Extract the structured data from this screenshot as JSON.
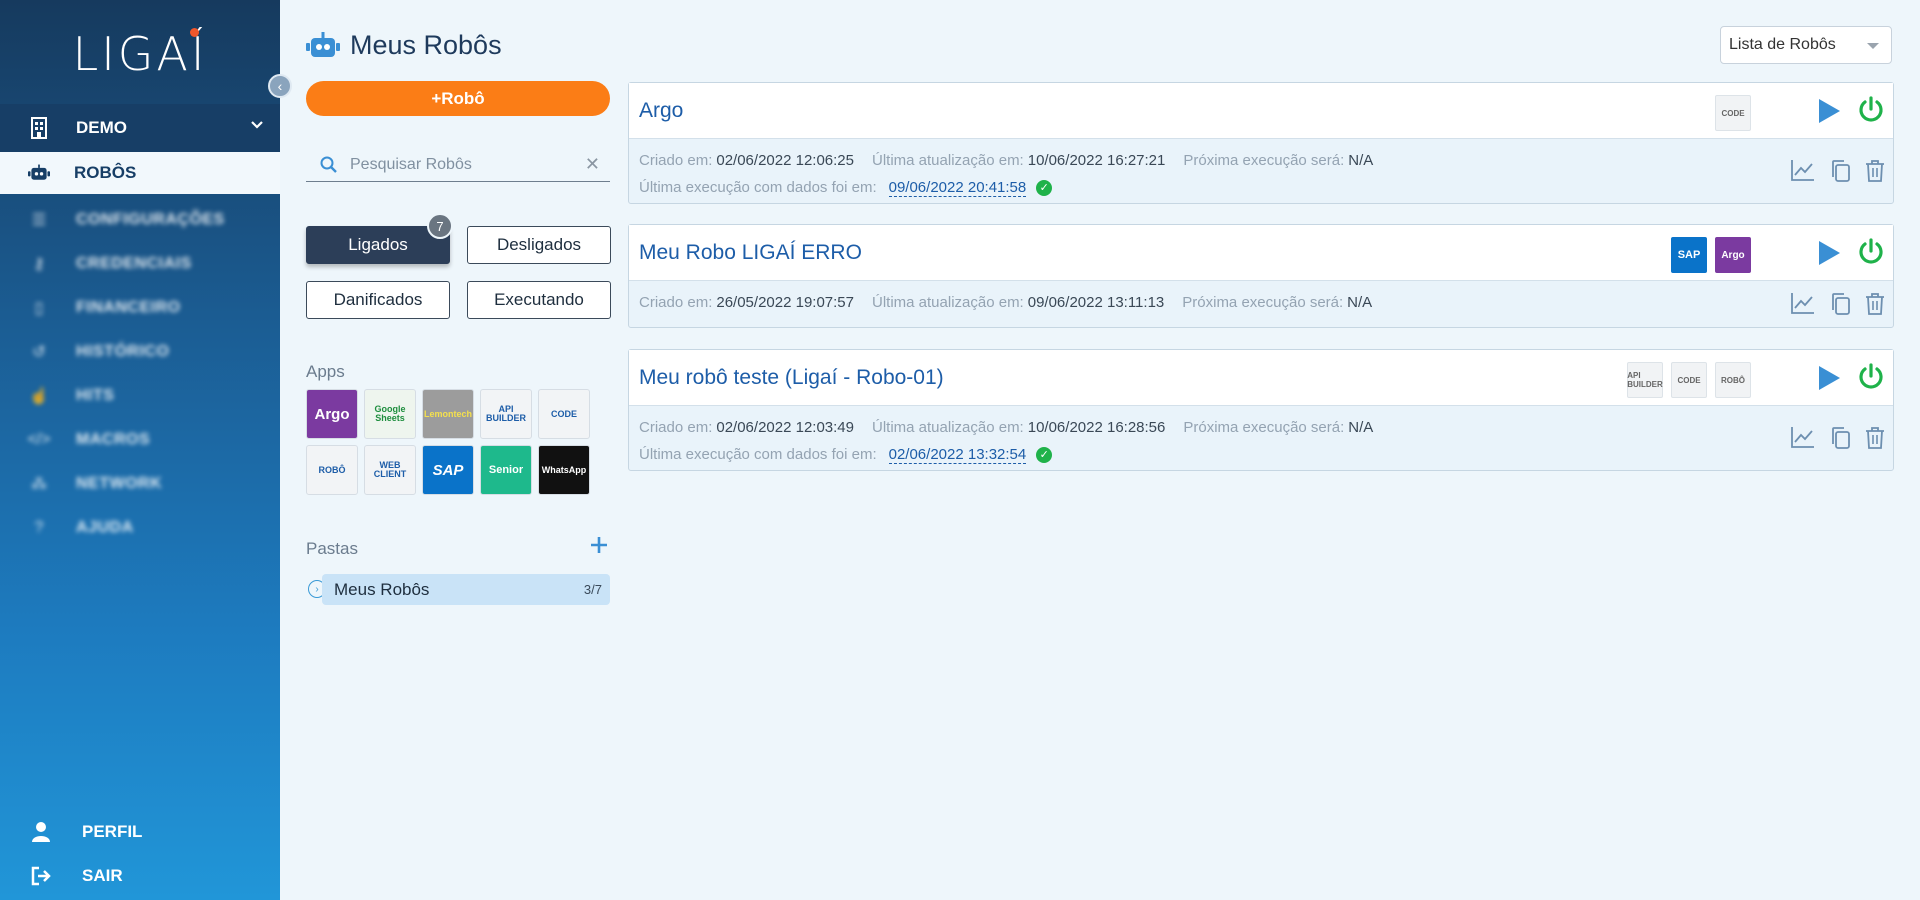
{
  "brand": {
    "logo_text": "LIGAÍ"
  },
  "sidebar": {
    "org": "DEMO",
    "active": "ROBÔS",
    "items": [
      "CONFIGURAÇÕES",
      "CREDENCIAIS",
      "FINANCEIRO",
      "HISTÓRICO",
      "HITS",
      "MACROS",
      "NETWORK",
      "AJUDA"
    ],
    "profile": "PERFIL",
    "logout": "SAIR"
  },
  "panel": {
    "title": "Meus Robôs",
    "add_label": "+Robô",
    "search_placeholder": "Pesquisar Robôs",
    "filters": {
      "on": "Ligados",
      "on_count": "7",
      "off": "Desligados",
      "broken": "Danificados",
      "running": "Executando"
    },
    "apps_label": "Apps",
    "apps": [
      {
        "label": "Argo",
        "bg": "#7b3aa0",
        "fg": "#ffffff"
      },
      {
        "label": "Google Sheets",
        "bg": "#eef5ee",
        "fg": "#1e8e3e"
      },
      {
        "label": "Lemontech",
        "bg": "#9c9c9c",
        "fg": "#f4e04d"
      },
      {
        "label": "API BUILDER",
        "bg": "#f2f4f6",
        "fg": "#1d5da8"
      },
      {
        "label": "CODE",
        "bg": "#f2f4f6",
        "fg": "#1d5da8"
      },
      {
        "label": "ROBÔ",
        "bg": "#f2f4f6",
        "fg": "#1d5da8"
      },
      {
        "label": "WEB CLIENT",
        "bg": "#f2f4f6",
        "fg": "#1d5da8"
      },
      {
        "label": "SAP",
        "bg": "#0a73c9",
        "fg": "#ffffff"
      },
      {
        "label": "Senior",
        "bg": "#1eb98c",
        "fg": "#ffffff"
      },
      {
        "label": "WhatsApp",
        "bg": "#111111",
        "fg": "#ffffff"
      }
    ],
    "folders_label": "Pastas",
    "folders": [
      {
        "name": "Meus Robôs",
        "count": "3/7"
      }
    ]
  },
  "view_select": {
    "value": "Lista de Robôs"
  },
  "labels": {
    "created": "Criado em:",
    "updated": "Última atualização em:",
    "next": "Próxima execução será:",
    "last_exec": "Última execução com dados foi em:"
  },
  "robots": [
    {
      "name": "Argo",
      "created": "02/06/2022 12:06:25",
      "updated": "10/06/2022 16:27:21",
      "next": "N/A",
      "last_exec": "09/06/2022 20:41:58",
      "apps": [
        "CODE"
      ]
    },
    {
      "name": "Meu Robo LIGAÍ ERRO",
      "created": "26/05/2022 19:07:57",
      "updated": "09/06/2022 13:11:13",
      "next": "N/A",
      "last_exec": "",
      "apps": [
        "SAP",
        "Argo"
      ]
    },
    {
      "name": "Meu robô teste (Ligaí - Robo-01)",
      "created": "02/06/2022 12:03:49",
      "updated": "10/06/2022 16:28:56",
      "next": "N/A",
      "last_exec": "02/06/2022 13:32:54",
      "apps": [
        "API BUILDER",
        "CODE",
        "ROBÔ"
      ]
    }
  ],
  "colors": {
    "accent": "#fb7d16",
    "power": "#1fb24a",
    "link": "#1d5da8"
  }
}
